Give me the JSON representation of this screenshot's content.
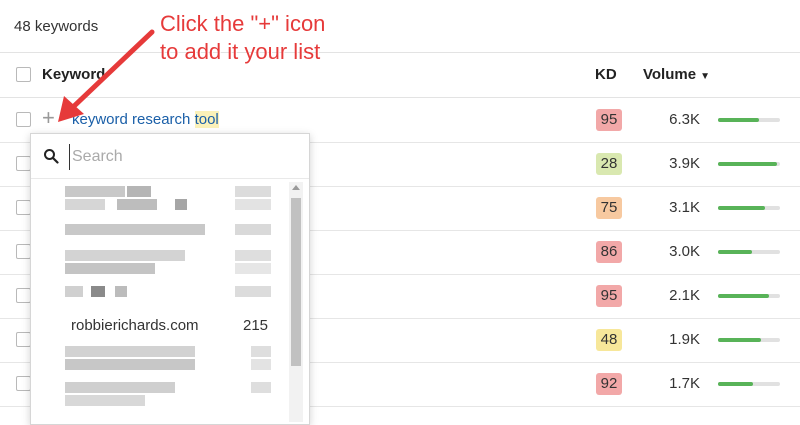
{
  "topbar": {
    "keyword_count": "48 keywords"
  },
  "table": {
    "headers": {
      "keyword": "Keyword",
      "kd": "KD",
      "volume": "Volume"
    },
    "rows": [
      {
        "keyword_prefix": "keyword research ",
        "keyword_highlight": "tool",
        "kd": "95",
        "kd_color": "#f2a8a8",
        "volume": "6.3K",
        "vol_fill": 0.66
      },
      {
        "kd": "28",
        "kd_color": "#d9e8b0",
        "volume": "3.9K",
        "vol_fill": 0.95
      },
      {
        "kd": "75",
        "kd_color": "#f7c9a0",
        "volume": "3.1K",
        "vol_fill": 0.76
      },
      {
        "kd": "86",
        "kd_color": "#f2a8a8",
        "volume": "3.0K",
        "vol_fill": 0.55
      },
      {
        "kd": "95",
        "kd_color": "#f2a8a8",
        "volume": "2.1K",
        "vol_fill": 0.82
      },
      {
        "kd": "48",
        "kd_color": "#f7e79a",
        "volume": "1.9K",
        "vol_fill": 0.7
      },
      {
        "kd": "92",
        "kd_color": "#f2a8a8",
        "volume": "1.7K",
        "vol_fill": 0.56
      }
    ]
  },
  "dropdown": {
    "search_placeholder": "Search",
    "visible_item": {
      "domain": "robbierichards.com",
      "count": "215"
    }
  },
  "annotation": {
    "line1": "Click the \"+\" icon",
    "line2": "to add it your list"
  },
  "colors": {
    "accent_red": "#e63a3a",
    "link_blue": "#1a5fa8",
    "bar_green": "#58b358"
  }
}
